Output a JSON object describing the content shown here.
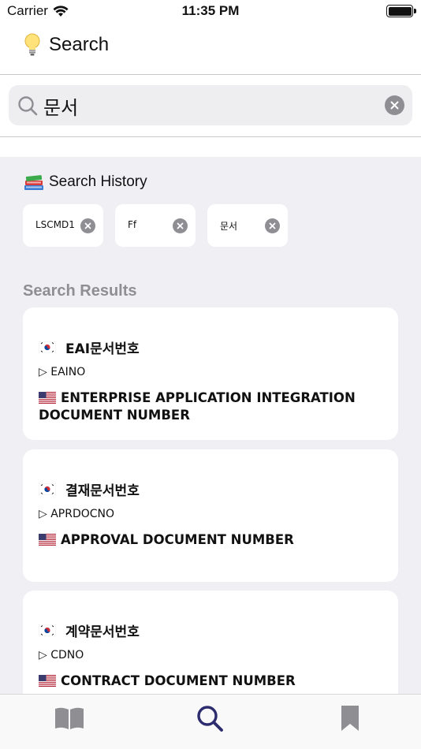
{
  "status": {
    "carrier": "Carrier",
    "time": "11:35 PM"
  },
  "nav": {
    "title": "Search",
    "icon": "lightbulb-icon"
  },
  "search": {
    "value": "문서",
    "placeholder": ""
  },
  "history": {
    "title": "Search History",
    "items": [
      {
        "label": "LSCMD1"
      },
      {
        "label": "Ff"
      },
      {
        "label": "문서"
      }
    ]
  },
  "results": {
    "title": "Search Results",
    "items": [
      {
        "ko": "EAI문서번호",
        "code": "▷ EAINO",
        "en": "ENTERPRISE APPLICATION INTEGRATION DOCUMENT NUMBER"
      },
      {
        "ko": "결재문서번호",
        "code": "▷ APRDOCNO",
        "en": "APPROVAL DOCUMENT NUMBER"
      },
      {
        "ko": "계약문서번호",
        "code": "▷ CDNO",
        "en": "CONTRACT DOCUMENT NUMBER"
      }
    ]
  },
  "tabs": [
    {
      "name": "dictionary",
      "icon": "book-icon"
    },
    {
      "name": "search",
      "icon": "search-icon",
      "active": true
    },
    {
      "name": "bookmarks",
      "icon": "bookmark-icon"
    }
  ],
  "colors": {
    "accent": "#2c2c6e",
    "inactive_tab": "#8e8e93",
    "background": "#efeff4"
  }
}
